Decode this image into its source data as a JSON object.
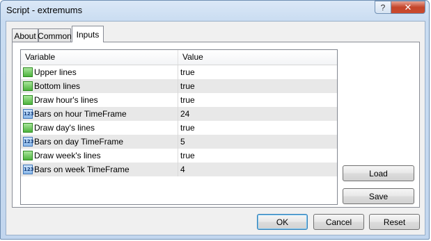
{
  "window": {
    "title": "Script - extremums",
    "help_label": "?",
    "close_label": "✕"
  },
  "tabs": [
    {
      "label": "About"
    },
    {
      "label": "Common"
    },
    {
      "label": "Inputs",
      "active": true
    }
  ],
  "grid": {
    "columns": [
      "Variable",
      "Value"
    ],
    "rows": [
      {
        "type": "bool",
        "icon": "boolean-param-icon",
        "variable": "Upper lines",
        "value": "true"
      },
      {
        "type": "bool",
        "icon": "boolean-param-icon",
        "variable": "Bottom lines",
        "value": "true"
      },
      {
        "type": "bool",
        "icon": "boolean-param-icon",
        "variable": "Draw hour's lines",
        "value": "true"
      },
      {
        "type": "int",
        "icon": "integer-param-icon",
        "icon_text": "123",
        "variable": "Bars on hour TimeFrame",
        "value": "24"
      },
      {
        "type": "bool",
        "icon": "boolean-param-icon",
        "variable": "Draw day's lines",
        "value": "true"
      },
      {
        "type": "int",
        "icon": "integer-param-icon",
        "icon_text": "123",
        "variable": "Bars on day TimeFrame",
        "value": "5"
      },
      {
        "type": "bool",
        "icon": "boolean-param-icon",
        "variable": "Draw week's lines",
        "value": "true"
      },
      {
        "type": "int",
        "icon": "integer-param-icon",
        "icon_text": "123",
        "variable": "Bars on week TimeFrame",
        "value": "4"
      }
    ]
  },
  "side_buttons": {
    "load_label": "Load",
    "save_label": "Save"
  },
  "footer": {
    "ok_label": "OK",
    "cancel_label": "Cancel",
    "reset_label": "Reset"
  }
}
